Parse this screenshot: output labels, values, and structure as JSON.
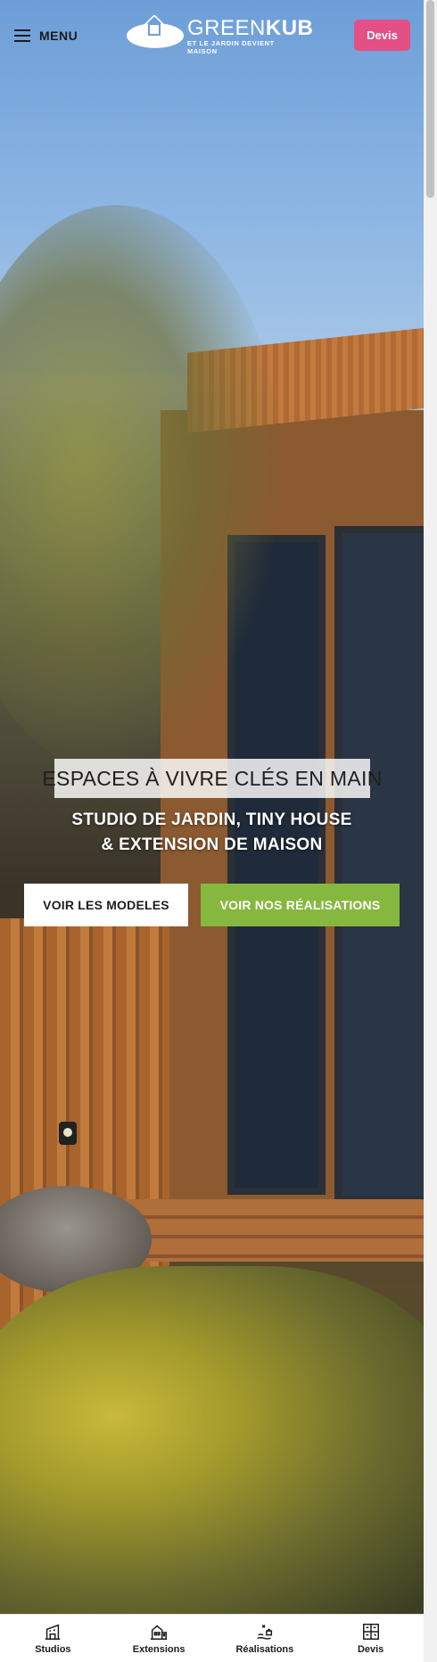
{
  "header": {
    "menu_label": "MENU",
    "logo": {
      "brand_light": "GREEN",
      "brand_bold": "KUB",
      "tagline": "ET LE JARDIN DEVIENT MAISON"
    },
    "devis_label": "Devis"
  },
  "hero": {
    "headline": "ESPACES À VIVRE CLÉS EN MAIN",
    "subline_1": "STUDIO DE JARDIN, TINY HOUSE",
    "subline_2": "& EXTENSION DE MAISON",
    "btn_models": "VOIR LES MODELES",
    "btn_realisations": "VOIR NOS RÉALISATIONS"
  },
  "bottom_nav": [
    {
      "label": "Studios",
      "icon": "studio-icon"
    },
    {
      "label": "Extensions",
      "icon": "extension-icon"
    },
    {
      "label": "Réalisations",
      "icon": "realisations-icon"
    },
    {
      "label": "Devis",
      "icon": "devis-grid-icon"
    }
  ],
  "colors": {
    "devis_pink": "#e44f86",
    "green_button": "#86b83f",
    "headline_bg": "#ffffff"
  }
}
